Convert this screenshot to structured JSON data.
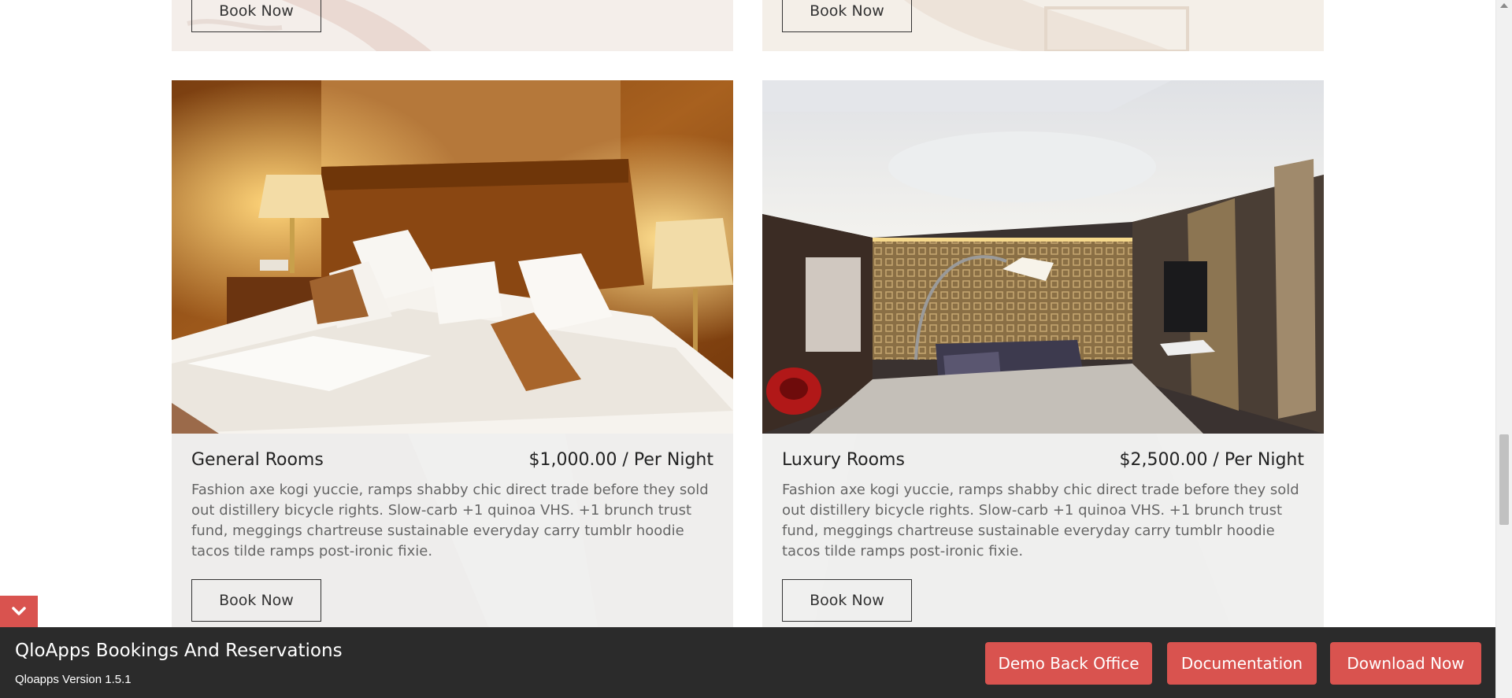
{
  "colors": {
    "accent": "#d9534f",
    "footer_bg": "#2b2b2b",
    "panel_bg": "#ececec",
    "text_dark": "#222222",
    "text_muted": "#666666"
  },
  "top_cards": [
    {
      "book_label": "Book Now"
    },
    {
      "book_label": "Book Now"
    }
  ],
  "rooms": [
    {
      "name": "General Rooms",
      "price": "$1,000.00 / Per Night",
      "description": "Fashion axe kogi yuccie, ramps shabby chic direct trade before they sold out distillery bicycle rights. Slow-carb +1 quinoa VHS. +1 brunch trust fund, meggings chartreuse sustainable everyday carry tumblr hoodie tacos tilde ramps post-ironic fixie.",
      "book_label": "Book Now"
    },
    {
      "name": "Luxury Rooms",
      "price": "$2,500.00 / Per Night",
      "description": "Fashion axe kogi yuccie, ramps shabby chic direct trade before they sold out distillery bicycle rights. Slow-carb +1 quinoa VHS. +1 brunch trust fund, meggings chartreuse sustainable everyday carry tumblr hoodie tacos tilde ramps post-ironic fixie.",
      "book_label": "Book Now"
    }
  ],
  "footer": {
    "title": "QloApps Bookings And Reservations",
    "version": "Qloapps Version 1.5.1",
    "buttons": [
      "Demo Back Office",
      "Documentation",
      "Download Now"
    ]
  },
  "icons": {
    "toggle": "chevron-down-icon"
  }
}
